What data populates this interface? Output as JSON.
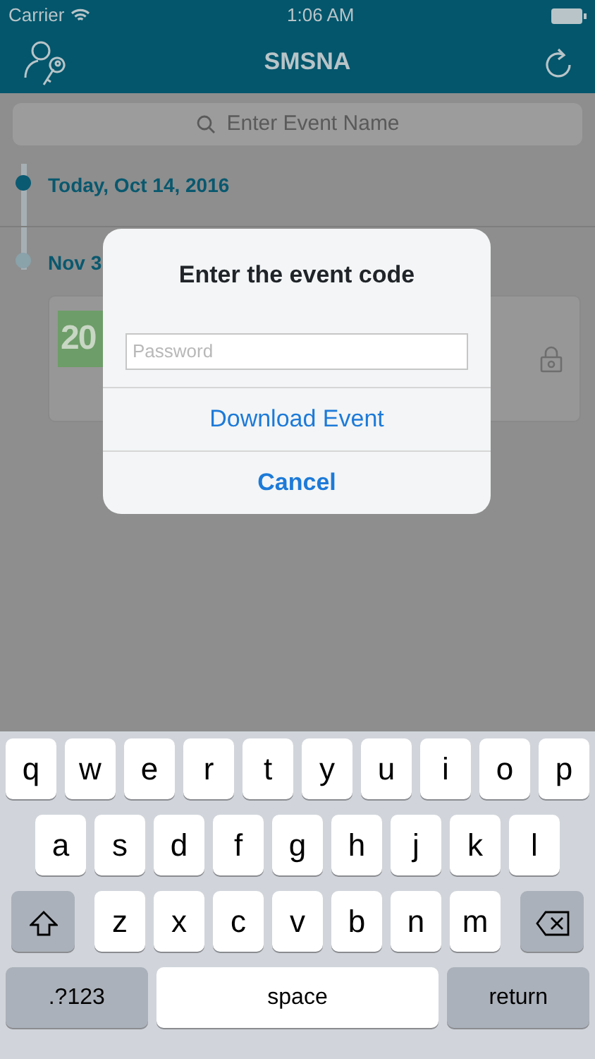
{
  "status_bar": {
    "carrier": "Carrier",
    "time": "1:06 AM"
  },
  "nav": {
    "title": "SMSNA"
  },
  "search": {
    "placeholder": "Enter Event Name"
  },
  "timeline": [
    {
      "date": "Today, Oct 14, 2016",
      "current": true
    },
    {
      "date": "Nov 3",
      "current": false,
      "card": {
        "thumbnail_text": "20",
        "locked": true
      }
    }
  ],
  "dialog": {
    "title": "Enter the event code",
    "field": {
      "placeholder": "Password"
    },
    "actions": [
      {
        "label": "Download Event",
        "kind": "normal"
      },
      {
        "label": "Cancel",
        "kind": "cancel"
      }
    ]
  },
  "keyboard": {
    "letter_rows": [
      [
        "q",
        "w",
        "e",
        "r",
        "t",
        "y",
        "u",
        "i",
        "o",
        "p"
      ],
      [
        "a",
        "s",
        "d",
        "f",
        "g",
        "h",
        "j",
        "k",
        "l"
      ],
      [
        "z",
        "x",
        "c",
        "v",
        "b",
        "n",
        "m"
      ]
    ],
    "bottom_keys": [
      {
        "label": ".?123",
        "kind": "mode"
      },
      {
        "label": "space",
        "kind": "space"
      },
      {
        "label": "return",
        "kind": "mode"
      }
    ]
  }
}
